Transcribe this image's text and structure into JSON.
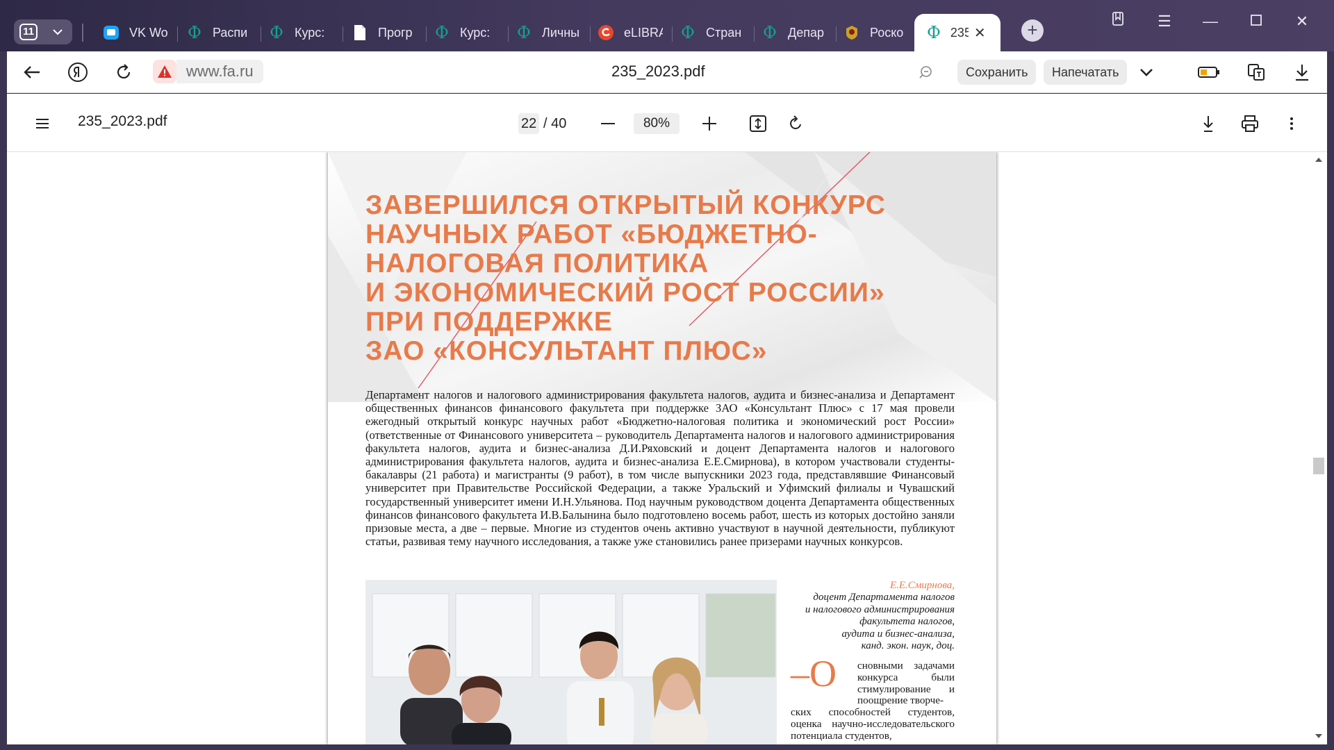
{
  "tabstrip": {
    "tab_count": "11",
    "tabs": [
      {
        "label": "VK Wo",
        "icon": "vk-messenger-icon"
      },
      {
        "label": "Распи",
        "icon": "fa-logo-icon"
      },
      {
        "label": "Курс:",
        "icon": "fa-logo-icon"
      },
      {
        "label": "Прогр",
        "icon": "document-icon"
      },
      {
        "label": "Курс:",
        "icon": "fa-logo-icon"
      },
      {
        "label": "Личны",
        "icon": "fa-logo-icon"
      },
      {
        "label": "eLIBRA",
        "icon": "elibrary-icon"
      },
      {
        "label": "Стран",
        "icon": "fa-logo-icon"
      },
      {
        "label": "Депар",
        "icon": "fa-logo-icon"
      },
      {
        "label": "Роско",
        "icon": "emblem-icon"
      }
    ],
    "active_tab": {
      "label": "235",
      "icon": "fa-logo-icon"
    },
    "fa_glyph": "Ф",
    "colors": {
      "fa_logo": "#13a08f",
      "background": "#3b3552"
    }
  },
  "toolbar": {
    "url": "www.fa.ru",
    "title": "235_2023.pdf",
    "save_label": "Сохранить",
    "print_label": "Напечатать"
  },
  "pdf": {
    "filename": "235_2023.pdf",
    "current_page": "22",
    "total_pages": "/ 40",
    "zoom": "80%"
  },
  "article": {
    "headline_lines": [
      "ЗАВЕРШИЛСЯ ОТКРЫТЫЙ КОНКУРС",
      "НАУЧНЫХ РАБОТ «БЮДЖЕТНО-",
      "НАЛОГОВАЯ ПОЛИТИКА",
      "И ЭКОНОМИЧЕСКИЙ РОСТ РОССИИ»",
      "ПРИ ПОДДЕРЖКЕ",
      "ЗАО «КОНСУЛЬТАНТ ПЛЮС»"
    ],
    "body": "Департамент налогов и налогового администрирования факультета налогов, аудита и бизнес-анализа и Департамент общественных финансов финансового факультета при поддержке ЗАО «Консультант Плюс» с 17 мая провели ежегодный открытый конкурс научных работ «Бюджетно-налоговая политика и экономический рост России» (ответственные от Финансового университета – руководитель Департамента налогов и налогового администрирования факультета налогов, аудита и бизнес-анализа Д.И.Ряховский и доцент Департамента налогов и налогового администрирования факультета налогов, аудита и бизнес-анализа Е.Е.Смирнова), в котором участвовали студенты-бакалавры (21 работа) и магистранты (9 работ), в том числе выпускники 2023 года, представлявшие Финансовый университет при Правительстве Российской Федерации, а также Уральский и Уфимский филиалы и Чувашский государственный университет имени И.Н.Ульянова. Под научным руководством доцента Департамента общественных финансов финансового факультета И.В.Балынина было подготовлено восемь работ, шесть из которых достойно заняли призовые места, а две – первые. Многие из студентов очень активно участвуют в научной деятельности, публикуют статьи, развивая тему научного исследования, а также уже становились ранее призерами научных конкурсов.",
    "author_name": "Е.Е.Смирнова,",
    "author_lines": [
      "доцент Департамента налогов",
      "и налогового администрирования",
      "факультета налогов,",
      "аудита и бизнес-анализа,",
      "канд. экон. наук, доц."
    ],
    "dropcap": "–О",
    "column_head": "сновными задачами конкурса были стимулирование и поощрение творче-",
    "column_rest": "ских способностей студентов, оценка научно-исследовательского потенциала студентов,",
    "accent_color": "#e87a4a"
  }
}
